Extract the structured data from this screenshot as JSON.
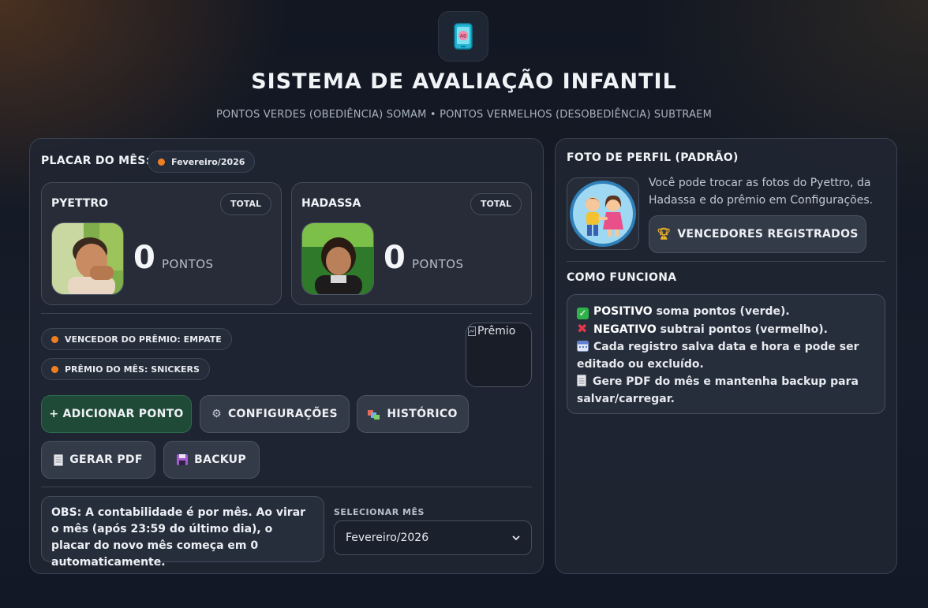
{
  "header": {
    "logo_icon": "phone-app-icon",
    "title": "SISTEMA DE AVALIAÇÃO INFANTIL",
    "subtitle": "PONTOS VERDES (OBEDIÊNCIA) SOMAM • PONTOS VERMELHOS (DESOBEDIÊNCIA) SUBTRAEM"
  },
  "scoreboard": {
    "title": "PLACAR DO MÊS:",
    "month_chip": "Fevereiro/2026",
    "players": [
      {
        "name": "PYETTRO",
        "badge": "TOTAL",
        "points": "0",
        "unit": "PONTOS"
      },
      {
        "name": "HADASSA",
        "badge": "TOTAL",
        "points": "0",
        "unit": "PONTOS"
      }
    ],
    "winner_chip": "VENCEDOR DO PRÊMIO: EMPATE",
    "prize_chip": "PRÊMIO DO MÊS: SNICKERS",
    "prize_image_alt": "Prêmio"
  },
  "actions": {
    "add_point": "+ ADICIONAR PONTO",
    "settings": "CONFIGURAÇÕES",
    "history": "HISTÓRICO",
    "pdf": "GERAR PDF",
    "backup": "BACKUP"
  },
  "footer": {
    "obs": "OBS: A contabilidade é por mês. Ao virar o mês (após 23:59 do último dia), o placar do novo mês começa em 0 automaticamente.",
    "select_label": "SELECIONAR MÊS",
    "select_value": "Fevereiro/2026"
  },
  "profile": {
    "title": "FOTO DE PERFIL (PADRÃO)",
    "note": "Você pode trocar as fotos do Pyettro, da Hadassa e do prêmio em Configurações.",
    "winners_button": "VENCEDORES REGISTRADOS"
  },
  "howto": {
    "title": "COMO FUNCIONA",
    "l1_strong": "POSITIVO",
    "l1_rest": " soma pontos (verde).",
    "l2_strong": "NEGATIVO",
    "l2_rest": " subtrai pontos (vermelho).",
    "l3": "Cada registro salva data e hora e pode ser editado ou excluído.",
    "l4": "Gere PDF do mês e mantenha backup para salvar/carregar."
  },
  "colors": {
    "accent_dot": "#f07f22",
    "green_button": "#1f4a37",
    "check_green": "#2fb24a",
    "cross_red": "#e2384e"
  }
}
